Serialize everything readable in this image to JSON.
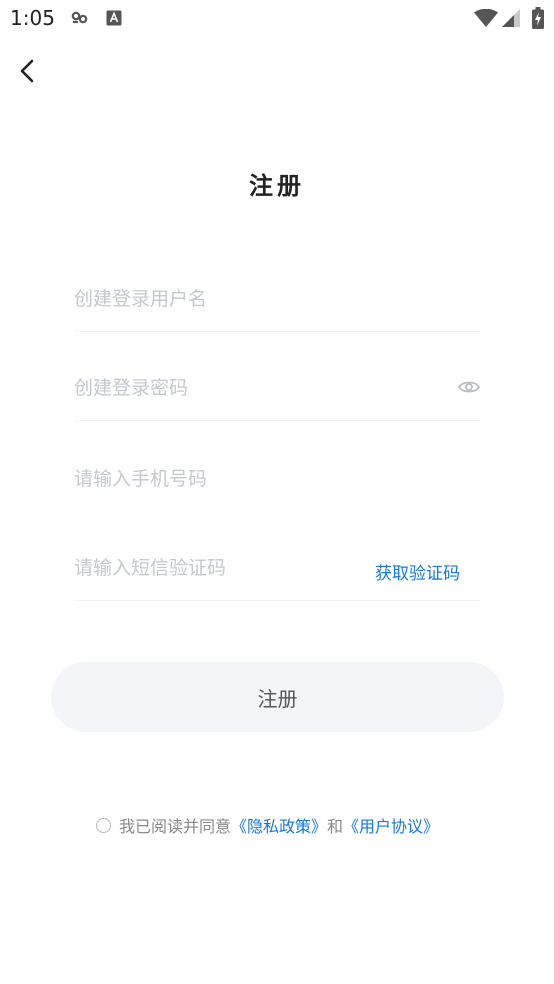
{
  "status_bar": {
    "time": "1:05",
    "icons": [
      "link-icon",
      "keyboard-a-icon",
      "wifi-icon",
      "signal-icon",
      "battery-charging-icon"
    ]
  },
  "nav": {
    "back_icon": "chevron-left-icon"
  },
  "title": "注册",
  "form": {
    "username": {
      "placeholder": "创建登录用户名",
      "value": ""
    },
    "password": {
      "placeholder": "创建登录密码",
      "value": "",
      "toggle_icon": "eye-icon"
    },
    "phone": {
      "placeholder": "请输入手机号码",
      "value": ""
    },
    "sms_code": {
      "placeholder": "请输入短信验证码",
      "value": "",
      "get_code_label": "获取验证码"
    }
  },
  "register_button": "注册",
  "agreement": {
    "checked": false,
    "prefix": "我已阅读并同意",
    "privacy_link": "《隐私政策》",
    "and": "和",
    "terms_link": "《用户协议》"
  },
  "colors": {
    "accent": "#1677e5",
    "placeholder": "#c4c8cf",
    "button_bg": "#f4f5f8",
    "title": "#222222"
  }
}
